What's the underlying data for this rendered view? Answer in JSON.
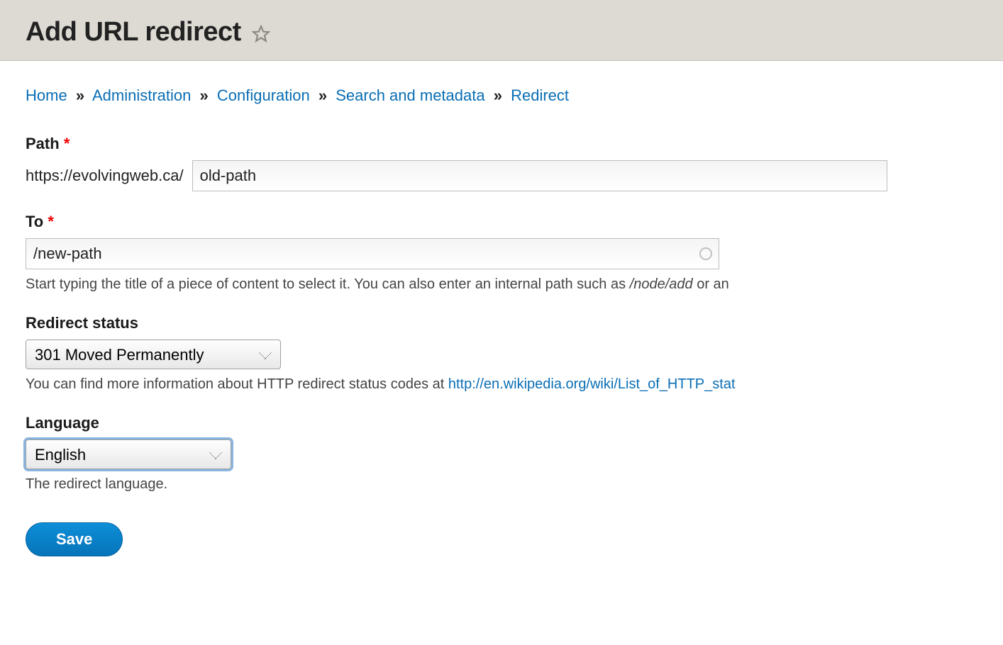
{
  "header": {
    "title": "Add URL redirect"
  },
  "breadcrumb": {
    "items": [
      "Home",
      "Administration",
      "Configuration",
      "Search and metadata",
      "Redirect"
    ],
    "sep": "»"
  },
  "form": {
    "path": {
      "label": "Path",
      "prefix": "https://evolvingweb.ca/",
      "value": "old-path"
    },
    "to": {
      "label": "To",
      "value": "/new-path",
      "help_prefix": "Start typing the title of a piece of content to select it. You can also enter an internal path such as ",
      "help_em": "/node/add",
      "help_suffix": " or an"
    },
    "status": {
      "label": "Redirect status",
      "value": "301 Moved Permanently",
      "help_prefix": "You can find more information about HTTP redirect status codes at ",
      "help_link": "http://en.wikipedia.org/wiki/List_of_HTTP_stat"
    },
    "language": {
      "label": "Language",
      "value": "English",
      "help": "The redirect language."
    },
    "save_label": "Save"
  }
}
